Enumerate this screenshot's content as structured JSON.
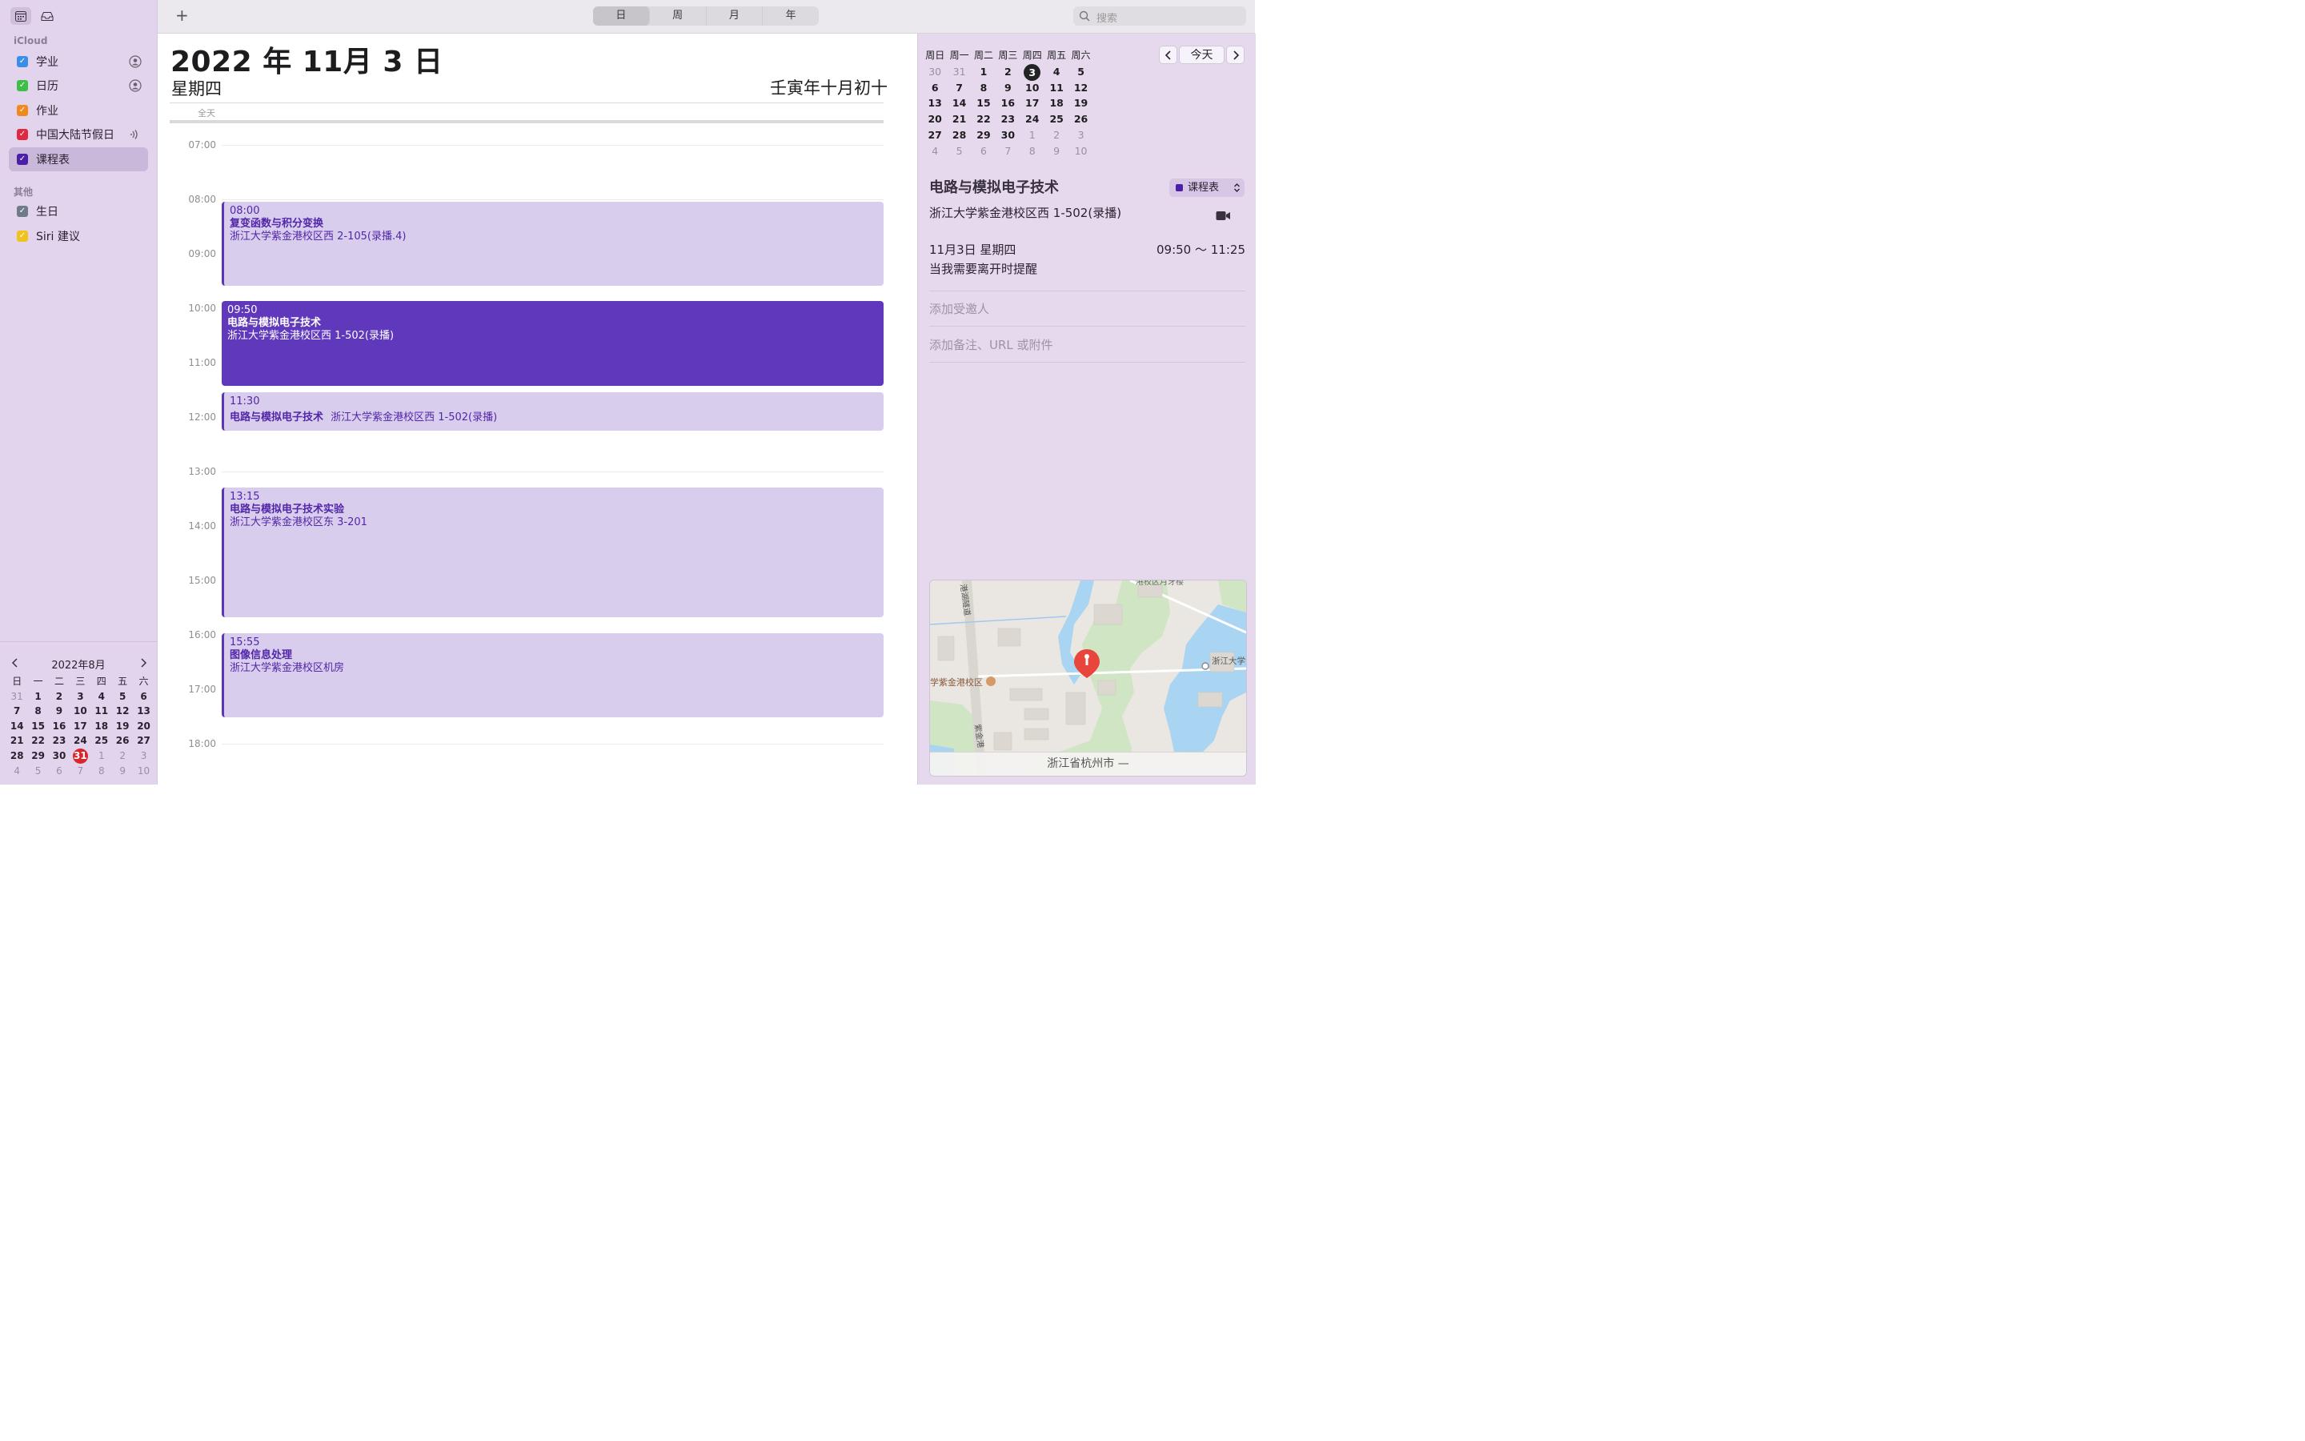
{
  "sidebar": {
    "icloud_label": "iCloud",
    "icloud_calendars": [
      {
        "label": "学业",
        "color": "#3b8ee8"
      },
      {
        "label": "日历",
        "color": "#3dbf47"
      },
      {
        "label": "作业",
        "color": "#f08a1c"
      },
      {
        "label": "中国大陆节假日",
        "color": "#e0283f"
      },
      {
        "label": "课程表",
        "color": "#4b1fa8"
      }
    ],
    "other_label": "其他",
    "other_calendars": [
      {
        "label": "生日",
        "color": "#6e7c8a"
      },
      {
        "label": "Siri 建议",
        "color": "#f0c21c"
      }
    ],
    "mini_calendar": {
      "title": "2022年8月",
      "weekdays": [
        "日",
        "一",
        "二",
        "三",
        "四",
        "五",
        "六"
      ],
      "days": [
        "31",
        "1",
        "2",
        "3",
        "4",
        "5",
        "6",
        "7",
        "8",
        "9",
        "10",
        "11",
        "12",
        "13",
        "14",
        "15",
        "16",
        "17",
        "18",
        "19",
        "20",
        "21",
        "22",
        "23",
        "24",
        "25",
        "26",
        "27",
        "28",
        "29",
        "30",
        "31",
        "1",
        "2",
        "3",
        "4",
        "5",
        "6",
        "7",
        "8",
        "9",
        "10"
      ],
      "today": "31"
    }
  },
  "toolbar": {
    "add_label": "+",
    "views": [
      "日",
      "周",
      "月",
      "年"
    ],
    "active_view": "日",
    "search_placeholder": "搜索"
  },
  "day_view": {
    "date_title": "2022 年 11月 3 日",
    "weekday": "星期四",
    "lunar_date": "壬寅年十月初十",
    "allday_label": "全天",
    "hours": [
      "07:00",
      "08:00",
      "09:00",
      "10:00",
      "11:00",
      "12:00",
      "13:00",
      "14:00",
      "15:00",
      "16:00",
      "17:00",
      "18:00"
    ],
    "events": [
      {
        "time": "08:00",
        "title": "复变函数与积分变换",
        "location": "浙江大学紫金港校区西 2-105(录播.4)",
        "style": "light"
      },
      {
        "time": "09:50",
        "title": "电路与模拟电子技术",
        "location": "浙江大学紫金港校区西 1-502(录播)",
        "style": "dark"
      },
      {
        "time": "11:30",
        "title": "电路与模拟电子技术",
        "location": "浙江大学紫金港校区西 1-502(录播)",
        "style": "light"
      },
      {
        "time": "13:15",
        "title": "电路与模拟电子技术实验",
        "location": "浙江大学紫金港校区东 3-201",
        "style": "light"
      },
      {
        "time": "15:55",
        "title": "图像信息处理",
        "location": "浙江大学紫金港校区机房",
        "style": "light"
      }
    ]
  },
  "right_panel": {
    "mini_calendar": {
      "weekdays": [
        "周日",
        "周一",
        "周二",
        "周三",
        "周四",
        "周五",
        "周六"
      ],
      "days": [
        "30",
        "31",
        "1",
        "2",
        "3",
        "4",
        "5",
        "6",
        "7",
        "8",
        "9",
        "10",
        "11",
        "12",
        "13",
        "14",
        "15",
        "16",
        "17",
        "18",
        "19",
        "20",
        "21",
        "22",
        "23",
        "24",
        "25",
        "26",
        "27",
        "28",
        "29",
        "30",
        "1",
        "2",
        "3",
        "4",
        "5",
        "6",
        "7",
        "8",
        "9",
        "10"
      ],
      "selected": "3",
      "today_button": "今天"
    },
    "event": {
      "title": "电路与模拟电子技术",
      "calendar": "课程表",
      "calendar_color": "#4b1fa8",
      "location": "浙江大学紫金港校区西 1-502(录播)",
      "date": "11月3日  星期四",
      "time_range": "09:50 ～ 11:25",
      "alert": "当我需要离开时提醒",
      "add_invitees": "添加受邀人",
      "add_notes": "添加备注、URL 或附件"
    },
    "map": {
      "caption": "浙江省杭州市 —",
      "label_campus": "学紫金港校区",
      "label_road1": "港湖隧道",
      "label_road2": "紫金港",
      "label_top": "港校区月牙楼",
      "label_right": "浙江大学港校区东"
    }
  }
}
